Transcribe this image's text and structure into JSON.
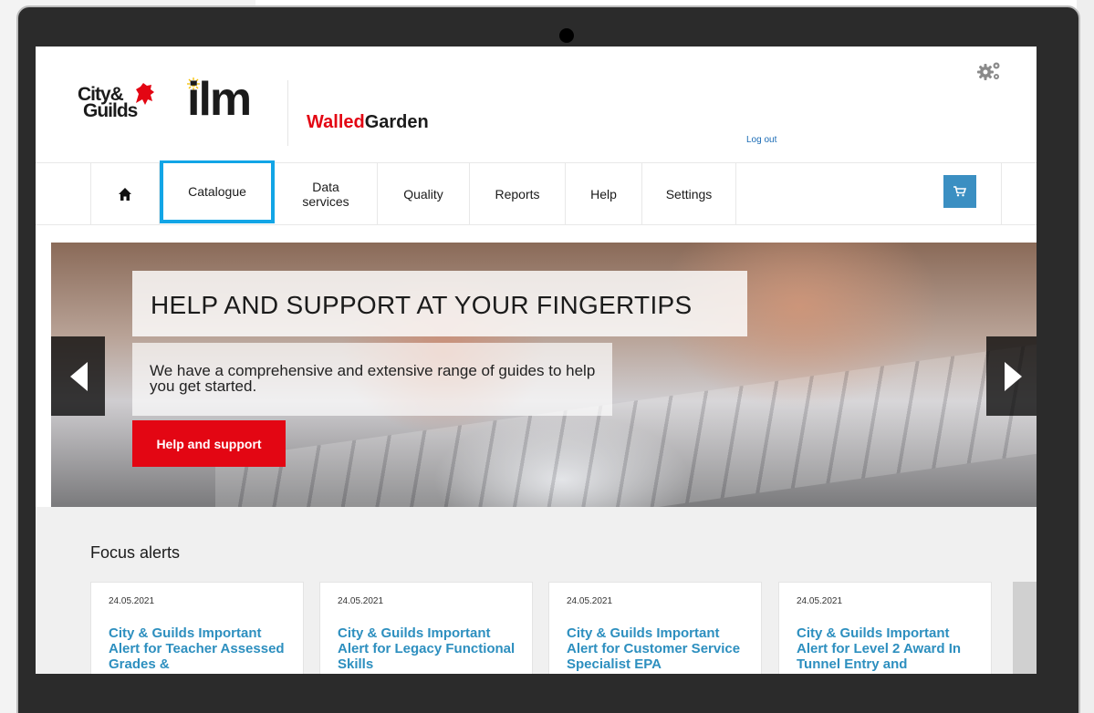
{
  "header": {
    "logo_city": "City&",
    "logo_guilds": "Guilds",
    "logo_ilm": "ilm",
    "brand_walled": "Walled",
    "brand_garden": "Garden",
    "logout_label": "Log out"
  },
  "nav": {
    "items": [
      {
        "label": "Catalogue"
      },
      {
        "label": "Data services"
      },
      {
        "label": "Quality"
      },
      {
        "label": "Reports"
      },
      {
        "label": "Help"
      },
      {
        "label": "Settings"
      }
    ]
  },
  "hero": {
    "title": "HELP AND SUPPORT AT YOUR FINGERTIPS",
    "subtitle": "We have a comprehensive and extensive range of guides to help you get started.",
    "button_label": "Help and support"
  },
  "alerts": {
    "title": "Focus alerts",
    "cards": [
      {
        "date": "24.05.2021",
        "title": "City & Guilds Important Alert for Teacher Assessed Grades &"
      },
      {
        "date": "24.05.2021",
        "title": "City & Guilds Important Alert for Legacy Functional Skills"
      },
      {
        "date": "24.05.2021",
        "title": "City & Guilds Important Alert for Customer Service Specialist EPA"
      },
      {
        "date": "24.05.2021",
        "title": "City & Guilds Important Alert for Level 2 Award In Tunnel Entry and"
      }
    ]
  },
  "colors": {
    "accent_red": "#e30613",
    "link_blue": "#2d8fbf",
    "cart_blue": "#3b8fc2",
    "highlight_cyan": "#12a5e6"
  }
}
